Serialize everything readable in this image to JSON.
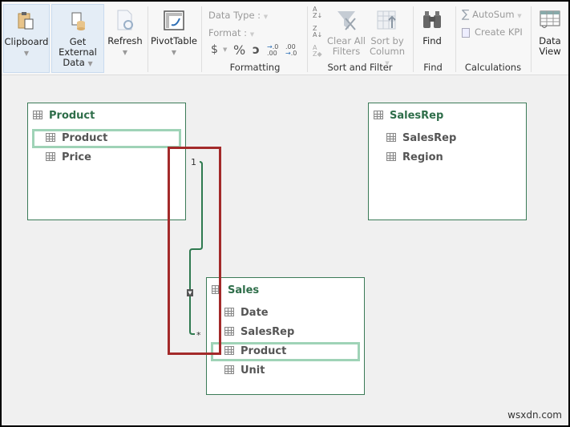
{
  "ribbon": {
    "buttons": [
      {
        "label": "Clipboard",
        "icon": "clipboard-icon"
      },
      {
        "label_line1": "Get External",
        "label_line2": "Data",
        "icon": "database-icon"
      },
      {
        "label": "Refresh",
        "icon": "refresh-icon"
      },
      {
        "label": "PivotTable",
        "icon": "pivottable-icon"
      }
    ],
    "formatting": {
      "data_type_label": "Data Type :",
      "format_label": "Format :",
      "currency_symbol": "$",
      "percent_symbol": "%",
      "comma_symbol": "ɔ",
      "increase_decimal": "→.0 .00",
      "decrease_decimal": ".00 →.0",
      "group_label": "Formatting"
    },
    "sort_filter": {
      "sort_az": "A↓Z",
      "sort_za": "Z↓A",
      "clear_sort": "A Z",
      "clear_all_filters_line1": "Clear All",
      "clear_all_filters_line2": "Filters",
      "sort_by_column_line1": "Sort by",
      "sort_by_column_line2": "Column",
      "group_label": "Sort and Filter"
    },
    "find": {
      "button_label": "Find",
      "group_label": "Find"
    },
    "calculations": {
      "autosum": "AutoSum",
      "create_kpi": "Create KPI",
      "group_label": "Calculations"
    },
    "view": {
      "line1": "Data",
      "line2": "View"
    }
  },
  "diagram": {
    "tables": [
      {
        "name": "Product",
        "fields": [
          "Product",
          "Price"
        ],
        "highlighted_field": "Product"
      },
      {
        "name": "SalesRep",
        "fields": [
          "SalesRep",
          "Region"
        ]
      },
      {
        "name": "Sales",
        "fields": [
          "Date",
          "SalesRep",
          "Product",
          "Unit"
        ],
        "highlighted_field": "Product"
      }
    ],
    "relationship": {
      "from": "Sales.Product",
      "to": "Product.Product",
      "one_label": "1",
      "many_label": "*"
    }
  },
  "watermark": "wsxdn.com"
}
